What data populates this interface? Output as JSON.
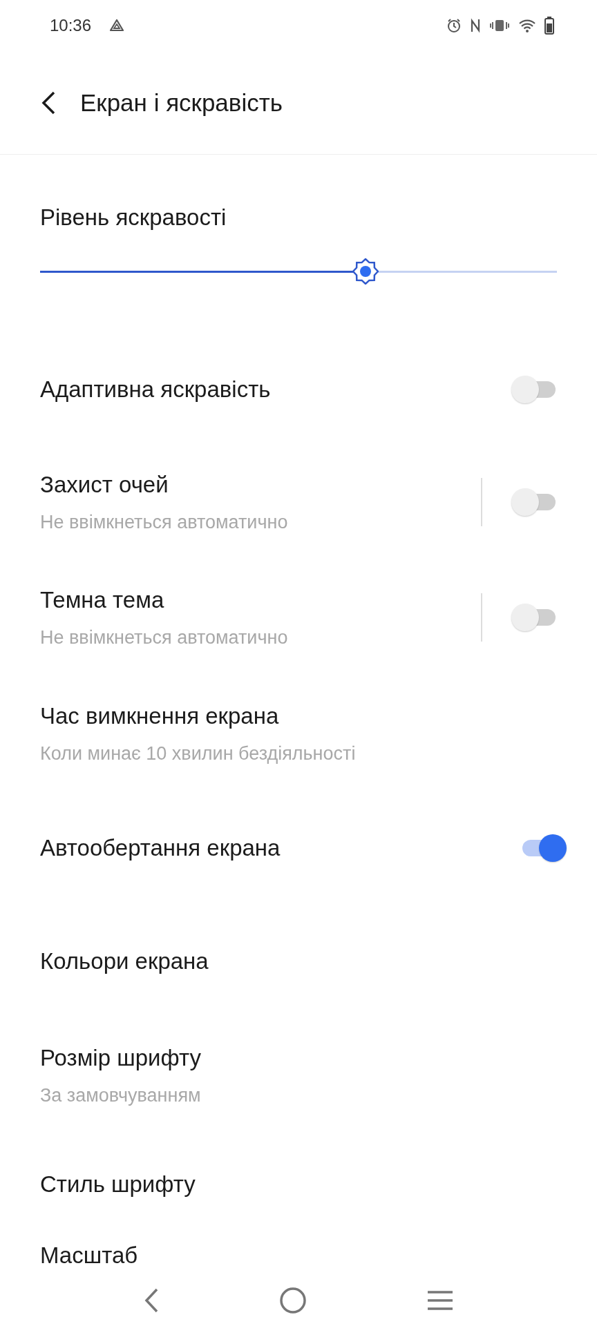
{
  "status_bar": {
    "time": "10:36"
  },
  "header": {
    "title": "Екран і яскравість"
  },
  "brightness": {
    "label": "Рівень яскравості",
    "level": 0.63
  },
  "items": [
    {
      "kind": "toggle",
      "title": "Адаптивна яскравість",
      "on": false
    },
    {
      "kind": "split_toggle",
      "title": "Захист очей",
      "subtitle": "Не ввімкнеться автоматично",
      "on": false
    },
    {
      "kind": "split_toggle",
      "title": "Темна тема",
      "subtitle": "Не ввімкнеться автоматично",
      "on": false
    },
    {
      "kind": "link",
      "title": "Час вимкнення екрана",
      "subtitle": "Коли минає 10 хвилин бездіяльності"
    },
    {
      "kind": "toggle",
      "title": "Автообертання екрана",
      "on": true
    },
    {
      "kind": "link",
      "title": "Кольори екрана"
    },
    {
      "kind": "link",
      "title": "Розмір шрифту",
      "subtitle": "За замовчуванням"
    },
    {
      "kind": "link",
      "title": "Стиль шрифту"
    },
    {
      "kind": "link",
      "title": "Масштаб"
    }
  ]
}
